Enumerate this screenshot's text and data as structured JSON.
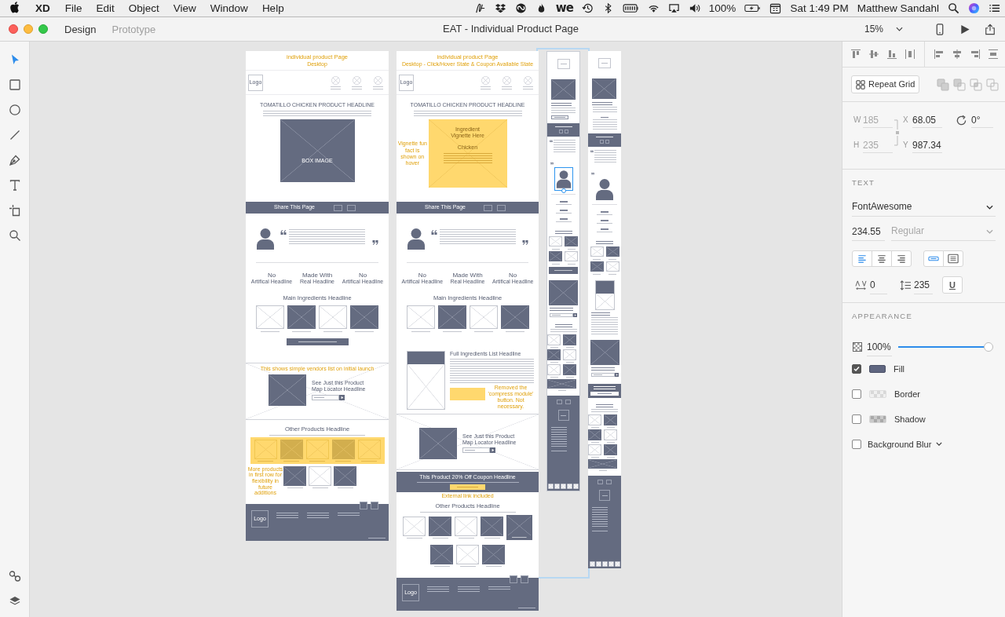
{
  "menu_bar": {
    "app": "XD",
    "menus": [
      "File",
      "Edit",
      "Object",
      "View",
      "Window",
      "Help"
    ],
    "status_logo": "we",
    "battery": "100%",
    "clock": "Sat 1:49 PM",
    "user": "Matthew Sandahl"
  },
  "title_bar": {
    "modes": [
      {
        "label": "Design",
        "selected": true
      },
      {
        "label": "Prototype",
        "selected": false
      }
    ],
    "title": "EAT - Individual Product Page",
    "zoom": "15%"
  },
  "tools": [
    {
      "kind": "select",
      "selected": true
    },
    {
      "kind": "rectangle",
      "selected": false
    },
    {
      "kind": "ellipse",
      "selected": false
    },
    {
      "kind": "line",
      "selected": false
    },
    {
      "kind": "pen",
      "selected": false
    },
    {
      "kind": "text",
      "selected": false
    },
    {
      "kind": "artboard",
      "selected": false
    },
    {
      "kind": "zoom",
      "selected": false
    }
  ],
  "bottom_tools": [
    {
      "kind": "symbols"
    },
    {
      "kind": "layers"
    }
  ],
  "artboards": [
    {
      "kind": "desktop",
      "sections": [
        {
          "kind": "note_title",
          "title": "individual product Page",
          "subtitle": "Desktop"
        },
        {
          "kind": "header",
          "logo": "Logo"
        },
        {
          "kind": "hero",
          "headline": "TOMATILLO CHICKEN PRODUCT HEADLINE",
          "image": {
            "kind": "box",
            "label": "BOX IMAGE"
          }
        },
        {
          "kind": "share",
          "label": "Share This Page"
        },
        {
          "kind": "testimonial",
          "avatar_selected": false
        },
        {
          "kind": "claims",
          "items": [
            {
              "title": "No",
              "subtitle": "Artifical Headline"
            },
            {
              "title": "Made With",
              "subtitle": "Real Headline"
            },
            {
              "title": "No",
              "subtitle": "Artifical Headline"
            }
          ]
        },
        {
          "kind": "ingredients",
          "headline": "Main Ingredients Headline",
          "items": [
            {
              "filled": false
            },
            {
              "filled": true
            },
            {
              "filled": false
            },
            {
              "filled": true
            }
          ],
          "cta": true
        },
        {
          "kind": "locator",
          "note": "This shows simple vendors list on initial launch",
          "headline": "See Just this Product Map Locator Headline"
        },
        {
          "kind": "other_products",
          "headline": "Other Products Headline",
          "note": "More products in first row for flexibility in future additions",
          "rows": [
            {
              "highlighted": true,
              "items": [
                {
                  "filled": false
                },
                {
                  "filled": true
                },
                {
                  "filled": false
                },
                {
                  "filled": true
                },
                {
                  "filled": false
                }
              ]
            },
            {
              "highlighted": false,
              "items": [
                {
                  "filled": true
                },
                {
                  "filled": false
                },
                {
                  "filled": true
                }
              ]
            }
          ]
        },
        {
          "kind": "footer",
          "logo": "Logo"
        }
      ]
    },
    {
      "kind": "desktop",
      "sections": [
        {
          "kind": "note_title",
          "title": "individual product Page",
          "subtitle": "Desktop - Click/Hover State & Coupon Available State"
        },
        {
          "kind": "header",
          "logo": "Logo"
        },
        {
          "kind": "hero",
          "headline": "TOMATILLO CHICKEN PRODUCT HEADLINE",
          "image": {
            "kind": "vignette",
            "title": "Ingredient Vignette Here",
            "heading": "Chicken",
            "note": "Vignette fun fact is shown on hover"
          }
        },
        {
          "kind": "share",
          "label": "Share This Page"
        },
        {
          "kind": "testimonial",
          "avatar_selected": false
        },
        {
          "kind": "claims",
          "items": [
            {
              "title": "No",
              "subtitle": "Artifical Headline"
            },
            {
              "title": "Made With",
              "subtitle": "Real Headline"
            },
            {
              "title": "No",
              "subtitle": "Artifical Headline"
            }
          ]
        },
        {
          "kind": "ingredients",
          "headline": "Main Ingredients Headline",
          "items": [
            {
              "filled": false
            },
            {
              "filled": true
            },
            {
              "filled": false
            },
            {
              "filled": true
            }
          ],
          "cta": false
        },
        {
          "kind": "full_ingredients",
          "headline": "Full Ingredients List Headline",
          "note": "Removed the 'compress module' button. Not necessary."
        },
        {
          "kind": "locator",
          "headline": "See Just this Product Map Locator Headline"
        },
        {
          "kind": "coupon",
          "headline": "This Product 20% Off Coupon Headline",
          "note": "External link included"
        },
        {
          "kind": "other_products",
          "headline": "Other Products Headline",
          "rows": [
            {
              "highlighted": false,
              "items": [
                {
                  "filled": false,
                  "hovered": false
                },
                {
                  "filled": true,
                  "hovered": false
                },
                {
                  "filled": false,
                  "hovered": false
                },
                {
                  "filled": true,
                  "hovered": false
                },
                {
                  "filled": true,
                  "hovered": true
                }
              ]
            },
            {
              "highlighted": false,
              "items": [
                {
                  "filled": true,
                  "hovered": false
                },
                {
                  "filled": false,
                  "hovered": false
                },
                {
                  "filled": true,
                  "hovered": false
                }
              ]
            }
          ]
        },
        {
          "kind": "footer",
          "logo": "Logo"
        }
      ]
    },
    {
      "kind": "mobile",
      "sections": [
        {
          "kind": "header"
        },
        {
          "kind": "hero",
          "image": {
            "kind": "box"
          },
          "vignette_open": false
        },
        {
          "kind": "share"
        },
        {
          "kind": "testimonial",
          "avatar_selected": true
        },
        {
          "kind": "claims"
        },
        {
          "kind": "ingredients",
          "items": [
            {
              "filled": false
            },
            {
              "filled": true
            },
            {
              "filled": true
            },
            {
              "filled": false
            }
          ],
          "cta": true
        },
        {
          "kind": "locator"
        },
        {
          "kind": "other_products",
          "rows": [
            {
              "highlighted": false,
              "items": [
                {
                  "filled": false
                },
                {
                  "filled": true
                }
              ]
            },
            {
              "highlighted": false,
              "items": [
                {
                  "filled": true
                },
                {
                  "filled": false
                }
              ]
            },
            {
              "highlighted": false,
              "items": [
                {
                  "filled": false
                },
                {
                  "filled": true
                }
              ]
            },
            {
              "highlighted": false,
              "items": [
                {
                  "filled": true
                }
              ]
            }
          ]
        },
        {
          "kind": "footer"
        }
      ]
    },
    {
      "kind": "mobile",
      "sections": [
        {
          "kind": "header"
        },
        {
          "kind": "hero",
          "image": {
            "kind": "box"
          },
          "vignette_open": true
        },
        {
          "kind": "share"
        },
        {
          "kind": "testimonial",
          "avatar_selected": false
        },
        {
          "kind": "claims"
        },
        {
          "kind": "ingredients",
          "items": [
            {
              "filled": false
            },
            {
              "filled": true
            },
            {
              "filled": true
            },
            {
              "filled": false
            }
          ],
          "cta": false
        },
        {
          "kind": "full_ingredients"
        },
        {
          "kind": "locator"
        },
        {
          "kind": "coupon"
        },
        {
          "kind": "other_products",
          "rows": [
            {
              "highlighted": false,
              "items": [
                {
                  "filled": false
                },
                {
                  "filled": true
                }
              ]
            },
            {
              "highlighted": false,
              "items": [
                {
                  "filled": true
                },
                {
                  "filled": false
                }
              ]
            },
            {
              "highlighted": false,
              "items": [
                {
                  "filled": false
                },
                {
                  "filled": true
                }
              ]
            },
            {
              "highlighted": false,
              "items": [
                {
                  "filled": true
                }
              ]
            }
          ]
        },
        {
          "kind": "footer"
        }
      ]
    }
  ],
  "properties": {
    "repeat_grid": "Repeat Grid",
    "geometry": [
      {
        "label": "W",
        "value": "185",
        "disabled": true
      },
      {
        "label": "X",
        "value": "68.05",
        "disabled": false
      },
      {
        "label": "H",
        "value": "235",
        "disabled": true
      },
      {
        "label": "Y",
        "value": "987.34",
        "disabled": false
      }
    ],
    "rotation": "0°",
    "text": {
      "heading": "TEXT",
      "font": "FontAwesome",
      "size": "234.55",
      "weight": "Regular",
      "weight_disabled": true,
      "align": [
        {
          "kind": "left",
          "selected": true
        },
        {
          "kind": "center",
          "selected": false
        },
        {
          "kind": "right",
          "selected": false
        }
      ],
      "sizing": [
        {
          "kind": "auto",
          "selected": true
        },
        {
          "kind": "fixed",
          "selected": false
        }
      ],
      "char_spacing": "0",
      "line_spacing": "235",
      "underline": {
        "label": "U",
        "selected": false
      }
    },
    "appearance": {
      "heading": "APPEARANCE",
      "opacity": "100%",
      "level": 1,
      "rows": [
        {
          "kind": "fill",
          "label": "Fill",
          "checked": true,
          "color": "#5f6680"
        },
        {
          "kind": "border",
          "label": "Border",
          "checked": false
        },
        {
          "kind": "shadow",
          "label": "Shadow",
          "checked": false
        },
        {
          "kind": "blur",
          "label": "Background Blur",
          "checked": false
        }
      ]
    }
  }
}
